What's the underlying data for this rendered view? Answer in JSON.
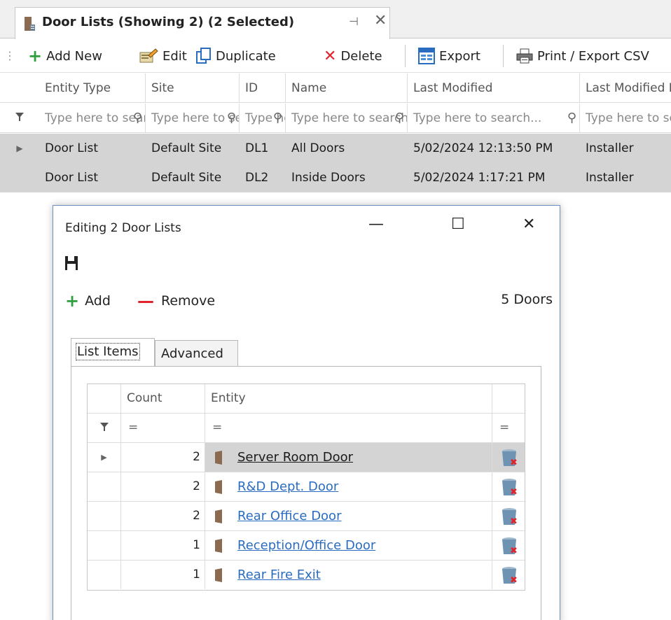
{
  "window": {
    "tab_title": "Door Lists (Showing 2) (2 Selected)",
    "pin_glyph": "⊣",
    "close_glyph": "✕"
  },
  "toolbar": {
    "add_new": "Add New",
    "edit": "Edit",
    "duplicate": "Duplicate",
    "delete": "Delete",
    "export": "Export",
    "print_export": "Print / Export CSV"
  },
  "grid": {
    "columns": [
      "Entity Type",
      "Site",
      "ID",
      "Name",
      "Last Modified",
      "Last Modified By"
    ],
    "filter_placeholders": [
      "Type here to search",
      "Type here to search",
      "Type here to search",
      "Type here to search",
      "Type here to search...",
      "Type here to search"
    ],
    "rows": [
      [
        "Door List",
        "Default Site",
        "DL1",
        "All Doors",
        "5/02/2024 12:13:50 PM",
        "Installer"
      ],
      [
        "Door List",
        "Default Site",
        "DL2",
        "Inside Doors",
        "5/02/2024 1:17:21 PM",
        "Installer"
      ]
    ]
  },
  "dialog": {
    "title": "Editing 2 Door Lists",
    "add_label": "Add",
    "remove_label": "Remove",
    "count_label": "5 Doors",
    "tabs": [
      "List Items",
      "Advanced"
    ],
    "columns": [
      "Count",
      "Entity"
    ],
    "filter_glyph": "=",
    "items": [
      {
        "count": "2",
        "entity": "Server Room Door"
      },
      {
        "count": "2",
        "entity": "R&D Dept. Door"
      },
      {
        "count": "2",
        "entity": "Rear Office Door"
      },
      {
        "count": "1",
        "entity": "Reception/Office Door"
      },
      {
        "count": "1",
        "entity": "Rear Fire Exit"
      }
    ]
  },
  "colors": {
    "accent_green": "#2e9e3e",
    "delete_red": "#e0242a",
    "link_blue": "#2a6cc0",
    "selection_gray": "#d4d4d4",
    "door_brown": "#8b6a4f"
  },
  "icons": {
    "tab": "door-list-icon",
    "add": "plus-icon",
    "edit": "edit-icon",
    "duplicate": "duplicate-icon",
    "delete": "delete-x-icon",
    "export": "export-icon",
    "print": "printer-icon",
    "filter": "funnel-icon",
    "search": "magnifier-icon",
    "save": "floppy-disk-icon",
    "door": "door-icon",
    "remove_row": "trash-bin-icon"
  }
}
